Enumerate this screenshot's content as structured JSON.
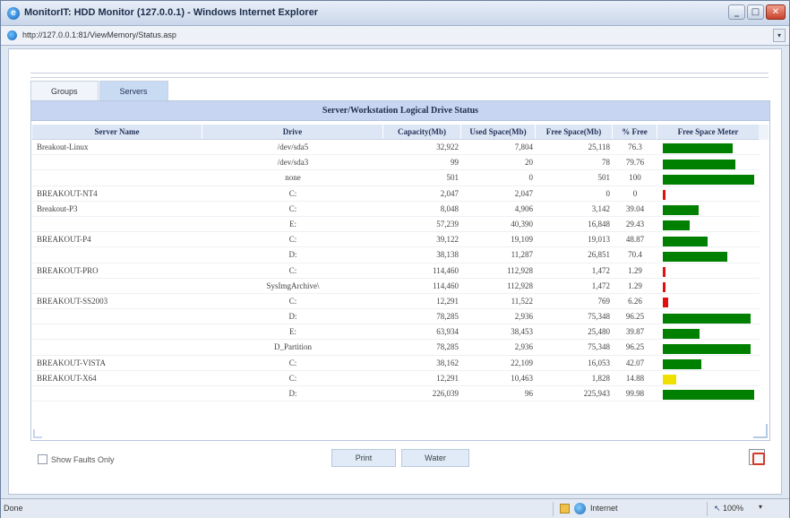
{
  "window": {
    "title": "MonitorIT: HDD Monitor (127.0.0.1) - Windows Internet Explorer",
    "url": "http://127.0.0.1:81/ViewMemory/Status.asp",
    "minimize_glyph": "_",
    "maximize_glyph": "□",
    "close_glyph": "✕",
    "ie_glyph": "e",
    "dropdown_glyph": "▾"
  },
  "tabs": [
    {
      "label": "Groups",
      "active": false
    },
    {
      "label": "Servers",
      "active": true
    }
  ],
  "panel": {
    "title": "Server/Workstation Logical Drive Status"
  },
  "grid": {
    "columns": [
      "Server Name",
      "Drive",
      "Capacity(Mb)",
      "Used Space(Mb)",
      "Free Space(Mb)",
      "% Free",
      "Free Space Meter"
    ],
    "rows": [
      {
        "server": "Breakout-Linux",
        "drive": "/dev/sda5",
        "capacity": "32,922",
        "used": "7,804",
        "free": "25,118",
        "pct": "76.3",
        "meter": 0.763,
        "color": "#008000"
      },
      {
        "server": "",
        "drive": "/dev/sda3",
        "capacity": "99",
        "used": "20",
        "free": "78",
        "pct": "79.76",
        "meter": 0.7976,
        "color": "#008000"
      },
      {
        "server": "",
        "drive": "none",
        "capacity": "501",
        "used": "0",
        "free": "501",
        "pct": "100",
        "meter": 1.0,
        "color": "#008000"
      },
      {
        "server": "BREAKOUT-NT4",
        "drive": "C:",
        "capacity": "2,047",
        "used": "2,047",
        "free": "0",
        "pct": "0",
        "meter": 0.0,
        "color": "#e01010"
      },
      {
        "server": "Breakout-P3",
        "drive": "C:",
        "capacity": "8,048",
        "used": "4,906",
        "free": "3,142",
        "pct": "39.04",
        "meter": 0.3904,
        "color": "#008000"
      },
      {
        "server": "",
        "drive": "E:",
        "capacity": "57,239",
        "used": "40,390",
        "free": "16,848",
        "pct": "29.43",
        "meter": 0.2943,
        "color": "#008000"
      },
      {
        "server": "BREAKOUT-P4",
        "drive": "C:",
        "capacity": "39,122",
        "used": "19,109",
        "free": "19,013",
        "pct": "48.87",
        "meter": 0.4887,
        "color": "#008000"
      },
      {
        "server": "",
        "drive": "D:",
        "capacity": "38,138",
        "used": "11,287",
        "free": "26,851",
        "pct": "70.4",
        "meter": 0.704,
        "color": "#008000"
      },
      {
        "server": "BREAKOUT-PRO",
        "drive": "C:",
        "capacity": "114,460",
        "used": "112,928",
        "free": "1,472",
        "pct": "1.29",
        "meter": 0.0129,
        "color": "#e01010"
      },
      {
        "server": "",
        "drive": "SysImgArchive\\",
        "capacity": "114,460",
        "used": "112,928",
        "free": "1,472",
        "pct": "1.29",
        "meter": 0.0129,
        "color": "#e01010"
      },
      {
        "server": "BREAKOUT-SS2003",
        "drive": "C:",
        "capacity": "12,291",
        "used": "11,522",
        "free": "769",
        "pct": "6.26",
        "meter": 0.0626,
        "color": "#e01010"
      },
      {
        "server": "",
        "drive": "D:",
        "capacity": "78,285",
        "used": "2,936",
        "free": "75,348",
        "pct": "96.25",
        "meter": 0.9625,
        "color": "#008000"
      },
      {
        "server": "",
        "drive": "E:",
        "capacity": "63,934",
        "used": "38,453",
        "free": "25,480",
        "pct": "39.87",
        "meter": 0.3987,
        "color": "#008000"
      },
      {
        "server": "",
        "drive": "D_Partition",
        "capacity": "78,285",
        "used": "2,936",
        "free": "75,348",
        "pct": "96.25",
        "meter": 0.9625,
        "color": "#008000"
      },
      {
        "server": "BREAKOUT-VISTA",
        "drive": "C:",
        "capacity": "38,162",
        "used": "22,109",
        "free": "16,053",
        "pct": "42.07",
        "meter": 0.4207,
        "color": "#008000"
      },
      {
        "server": "BREAKOUT-X64",
        "drive": "C:",
        "capacity": "12,291",
        "used": "10,463",
        "free": "1,828",
        "pct": "14.88",
        "meter": 0.1488,
        "color": "#f0e000"
      },
      {
        "server": "",
        "drive": "D:",
        "capacity": "226,039",
        "used": "96",
        "free": "225,943",
        "pct": "99.98",
        "meter": 0.9998,
        "color": "#008000"
      }
    ]
  },
  "footer": {
    "show_faults_label": "Show Faults Only",
    "print_label": "Print",
    "water_label": "Water"
  },
  "statusbar": {
    "status": "Done",
    "zone": "Internet",
    "zoom": "100%",
    "zoom_glyph": "↖",
    "dropdown_glyph": "▾"
  }
}
